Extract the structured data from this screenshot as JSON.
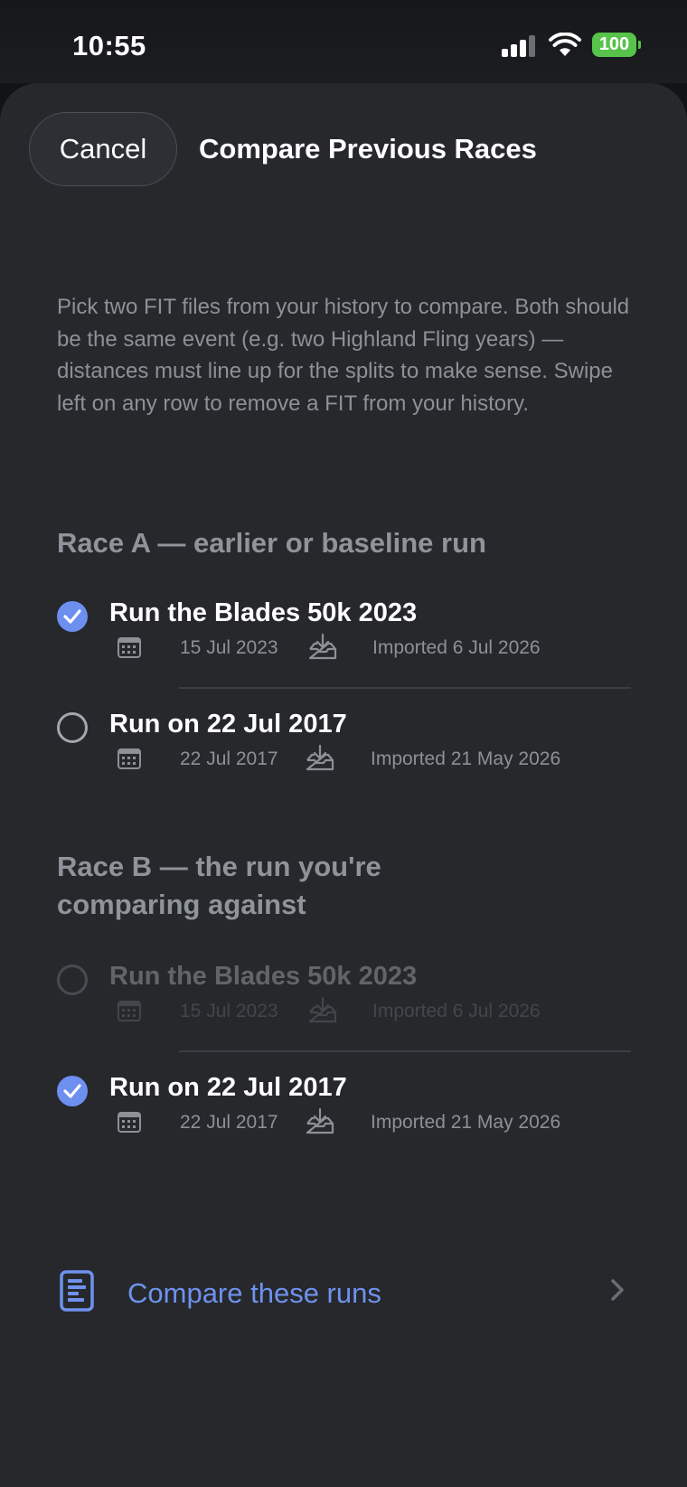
{
  "status_bar": {
    "time": "10:55",
    "battery": "100"
  },
  "header": {
    "cancel_label": "Cancel",
    "title": "Compare Previous Races"
  },
  "description": "Pick two FIT files from your history to compare. Both should be the same event (e.g. two Highland Fling years) — distances must line up for the splits to make sense. Swipe left on any row to remove a FIT from your history.",
  "race_a": {
    "title": "Race A — earlier or baseline run",
    "items": [
      {
        "name": "Run the Blades 50k 2023",
        "date": "15 Jul 2023",
        "imported": "Imported 6 Jul 2026",
        "selected": true
      },
      {
        "name": "Run on 22 Jul 2017",
        "date": "22 Jul 2017",
        "imported": "Imported 21 May 2026",
        "selected": false
      }
    ]
  },
  "race_b": {
    "title_line1": "Race B — the run you're",
    "title_line2": "comparing against",
    "items": [
      {
        "name": "Run the Blades 50k 2023",
        "date": "15 Jul 2023",
        "imported": "Imported 6 Jul 2026",
        "selected": false,
        "disabled": true
      },
      {
        "name": "Run on 22 Jul 2017",
        "date": "22 Jul 2017",
        "imported": "Imported 21 May 2026",
        "selected": true
      }
    ]
  },
  "compare": {
    "label": "Compare these runs"
  },
  "colors": {
    "accent": "#6d8ff0",
    "link": "#6f92ee",
    "battery": "#57c34a",
    "sheet": "#26282c"
  },
  "icons": [
    "calendar-icon",
    "import-tray-icon",
    "checkmark-icon",
    "document-chart-icon",
    "chevron-right-icon",
    "wifi-icon",
    "signal-icon"
  ]
}
